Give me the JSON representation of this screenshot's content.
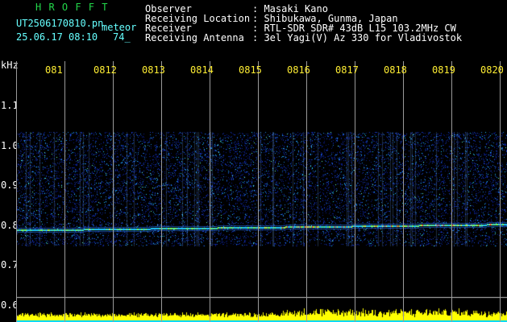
{
  "app": {
    "name": "H R O F F T",
    "filename": "UT2506170810.pn",
    "suffix": "meteor",
    "datetime": "25.06.17 08:10",
    "count": "74_"
  },
  "info": {
    "rows": [
      {
        "label": "Observer",
        "value": ": Masaki Kano"
      },
      {
        "label": "Receiving Location",
        "value": ": Shibukawa, Gunma, Japan"
      },
      {
        "label": "Receiver",
        "value": ": RTL-SDR SDR# 43dB L15 103.2MHz CW"
      },
      {
        "label": "Receiving Antenna",
        "value": ": 3el Yagi(V) Az 330 for Vladivostok"
      }
    ]
  },
  "axis": {
    "unit": "kHz",
    "y_ticks": [
      "1.1",
      "1.0",
      "0.9",
      "0.8",
      "0.7",
      "0.6"
    ],
    "time_ticks": [
      "081",
      "0812",
      "0813",
      "0814",
      "0815",
      "0816",
      "0817",
      "0818",
      "0819",
      "0820"
    ]
  },
  "colors": {
    "background": "#000000",
    "title": "#22d84a",
    "filename": "#66ffff",
    "time_labels": "#ffee33",
    "signal_low": "#1a3cc8",
    "signal_mid": "#22c8ff",
    "signal_high": "#ff2020",
    "meteor_bar": "#ffff00",
    "baseline": "#00d8ff"
  }
}
